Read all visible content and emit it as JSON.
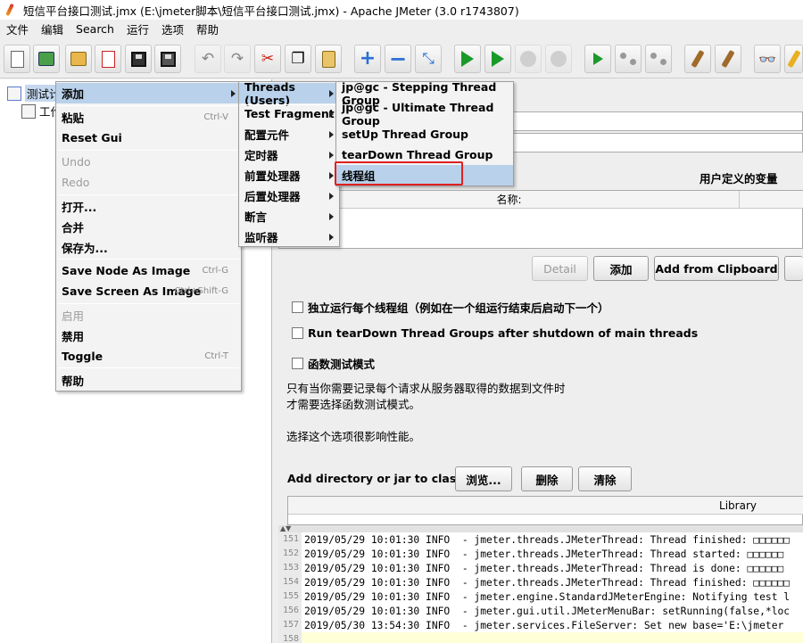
{
  "window": {
    "title": "短信平台接口测试.jmx (E:\\jmeter脚本\\短信平台接口测试.jmx) - Apache JMeter (3.0 r1743807)"
  },
  "menubar": [
    "文件",
    "编辑",
    "Search",
    "运行",
    "选项",
    "帮助"
  ],
  "toolbar": [
    "new-icon",
    "templates-icon",
    "open-icon",
    "close-icon",
    "save-icon",
    "save-as-icon",
    "undo-icon",
    "redo-icon",
    "cut-icon",
    "copy-icon",
    "paste-icon",
    "expand-icon",
    "collapse-icon",
    "toggle-icon",
    "start-icon",
    "start-no-pause-icon",
    "stop-icon",
    "shutdown-icon",
    "remote-start-icon",
    "remote-stop-icon",
    "remote-exit-icon",
    "clear-icon",
    "clear-all-icon",
    "search-icon",
    "reset-search-icon"
  ],
  "tree": {
    "items": [
      "测试计划",
      "工作台"
    ]
  },
  "context_menu": {
    "items": [
      {
        "label": "添加",
        "shortcut": "",
        "submenu": true,
        "highlighted": true,
        "disabled": false
      },
      {
        "label": "粘贴",
        "shortcut": "Ctrl-V",
        "disabled": false
      },
      {
        "label": "Reset Gui",
        "shortcut": "",
        "disabled": false
      },
      {
        "label": "Undo",
        "shortcut": "",
        "disabled": true
      },
      {
        "label": "Redo",
        "shortcut": "",
        "disabled": true
      },
      {
        "label": "打开...",
        "shortcut": "",
        "disabled": false
      },
      {
        "label": "合并",
        "shortcut": "",
        "disabled": false
      },
      {
        "label": "保存为...",
        "shortcut": "",
        "disabled": false
      },
      {
        "label": "Save Node As Image",
        "shortcut": "Ctrl-G",
        "disabled": false
      },
      {
        "label": "Save Screen As Image",
        "shortcut": "Ctrl+Shift-G",
        "disabled": false
      },
      {
        "label": "启用",
        "shortcut": "",
        "disabled": true
      },
      {
        "label": "禁用",
        "shortcut": "",
        "disabled": false
      },
      {
        "label": "Toggle",
        "shortcut": "Ctrl-T",
        "disabled": false
      },
      {
        "label": "帮助",
        "shortcut": "",
        "disabled": false
      }
    ]
  },
  "add_submenu": {
    "items": [
      "Threads (Users)",
      "Test Fragment",
      "配置元件",
      "定时器",
      "前置处理器",
      "后置处理器",
      "断言",
      "监听器"
    ]
  },
  "threads_submenu": {
    "items": [
      "jp@gc - Stepping Thread Group",
      "jp@gc - Ultimate Thread Group",
      "setUp Thread Group",
      "tearDown Thread Group",
      "线程组"
    ]
  },
  "panel": {
    "user_vars_title": "用户定义的变量",
    "name_col": "名称:",
    "buttons": {
      "detail": "Detail",
      "add": "添加",
      "add_clipboard": "Add from Clipboard"
    },
    "checkbox_serial": "独立运行每个线程组（例如在一个组运行结束后启动下一个）",
    "checkbox_teardown": "Run tearDown Thread Groups after shutdown of main threads",
    "checkbox_functional": "函数测试模式",
    "note1": "只有当你需要记录每个请求从服务器取得的数据到文件时",
    "note2": "才需要选择函数测试模式。",
    "note3": "选择这个选项很影响性能。",
    "classpath_label": "Add directory or jar to classpath",
    "browse": "浏览...",
    "delete": "删除",
    "clear": "清除",
    "library_col": "Library"
  },
  "log": {
    "rows": [
      {
        "n": "151",
        "t": "2019/05/29 10:01:30 INFO  - jmeter.threads.JMeterThread: Thread finished: □□□□□□"
      },
      {
        "n": "152",
        "t": "2019/05/29 10:01:30 INFO  - jmeter.threads.JMeterThread: Thread started: □□□□□□"
      },
      {
        "n": "153",
        "t": "2019/05/29 10:01:30 INFO  - jmeter.threads.JMeterThread: Thread is done: □□□□□□"
      },
      {
        "n": "154",
        "t": "2019/05/29 10:01:30 INFO  - jmeter.threads.JMeterThread: Thread finished: □□□□□□"
      },
      {
        "n": "155",
        "t": "2019/05/29 10:01:30 INFO  - jmeter.engine.StandardJMeterEngine: Notifying test l"
      },
      {
        "n": "156",
        "t": "2019/05/29 10:01:30 INFO  - jmeter.gui.util.JMeterMenuBar: setRunning(false,*loc"
      },
      {
        "n": "157",
        "t": "2019/05/30 13:54:30 INFO  - jmeter.services.FileServer: Set new base='E:\\jmeter"
      },
      {
        "n": "158",
        "t": ""
      }
    ]
  }
}
